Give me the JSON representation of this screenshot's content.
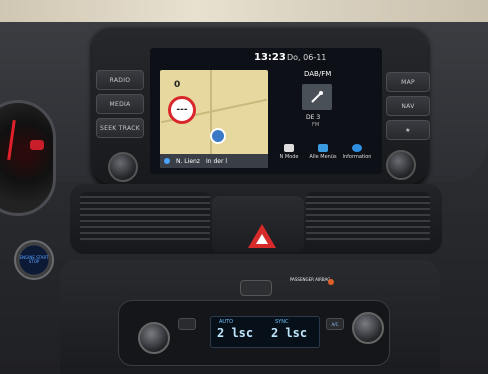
{
  "screen": {
    "time": "13:23",
    "date": "Do, 06-11",
    "speed_value": "0",
    "speed_limit": "---",
    "street_left": "N. Lienz",
    "street_right": "In der l",
    "source": "DAB/FM",
    "station": "DE 3",
    "band": "FM",
    "bottom_items": [
      "N Mode",
      "Alle Menüs",
      "Information"
    ]
  },
  "head_unit_buttons": {
    "left": [
      "RADIO",
      "MEDIA",
      "SEEK TRACK"
    ],
    "right": [
      "MAP",
      "NAV",
      "★"
    ]
  },
  "start_button": "ENGINE START STOP",
  "airbag": "PASSENGER AIRBAG",
  "climate": {
    "left_tag": "AUTO",
    "left_temp": "2 lsc",
    "right_tag": "SYNC",
    "right_temp": "2 lsc",
    "buttons": [
      "A/C"
    ]
  },
  "colors": {
    "hazard": "#d72a2a",
    "map": "#e6d89e",
    "lcd_text": "#bfe6ff"
  }
}
